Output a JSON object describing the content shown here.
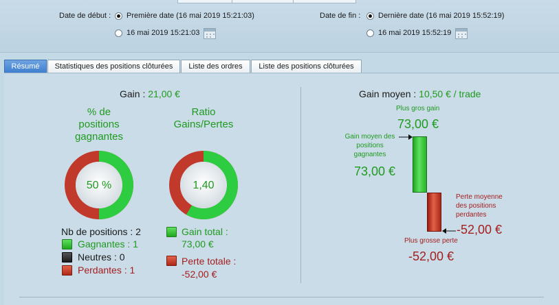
{
  "header": {
    "start_label": "Date de début :",
    "start_opt_first": "Première date (16 mai 2019 15:21:03)",
    "start_opt_custom": "16 mai 2019 15:21:03",
    "end_label": "Date de fin :",
    "end_opt_last": "Dernière date (16 mai 2019 15:52:19)",
    "end_opt_custom": "16 mai 2019 15:52:19"
  },
  "tabs": [
    "Résumé",
    "Statistiques des positions clôturées",
    "Liste des ordres",
    "Liste des positions clôturées"
  ],
  "left": {
    "gain_label": "Gain :",
    "gain_value": "21,00 €",
    "pct_title_1": "% de",
    "pct_title_2": "positions",
    "pct_title_3": "gagnantes",
    "pct_value": "50 %",
    "pct_fraction": 0.5,
    "ratio_title_1": "Ratio",
    "ratio_title_2": "Gains/Pertes",
    "ratio_value": "1,40",
    "ratio_fraction": 0.5833,
    "nb_positions": "Nb de positions : 2",
    "gagnantes": "Gagnantes : 1",
    "neutres": "Neutres : 0",
    "perdantes": "Perdantes : 1",
    "gain_total_label": "Gain total :",
    "gain_total_value": "73,00 €",
    "perte_totale_label": "Perte totale :",
    "perte_totale_value": "-52,00 €"
  },
  "right": {
    "gain_moyen_label": "Gain moyen :",
    "gain_moyen_value": "10,50 € / trade",
    "plus_gros_gain_label": "Plus gros gain",
    "plus_gros_gain_value": "73,00 €",
    "gain_moyen_gagnantes_1": "Gain moyen des",
    "gain_moyen_gagnantes_2": "positions",
    "gain_moyen_gagnantes_3": "gagnantes",
    "gain_moyen_gagnantes_value": "73,00 €",
    "perte_moyenne_1": "Perte moyenne",
    "perte_moyenne_2": "des positions",
    "perte_moyenne_3": "perdantes",
    "perte_moyenne_value": "-52,00 €",
    "plus_grosse_perte_label": "Plus grosse perte",
    "plus_grosse_perte_value": "-52,00 €"
  },
  "colors": {
    "green": "#1f9a1f",
    "red": "#a51d1d",
    "active_tab": "#3f7fd0"
  }
}
